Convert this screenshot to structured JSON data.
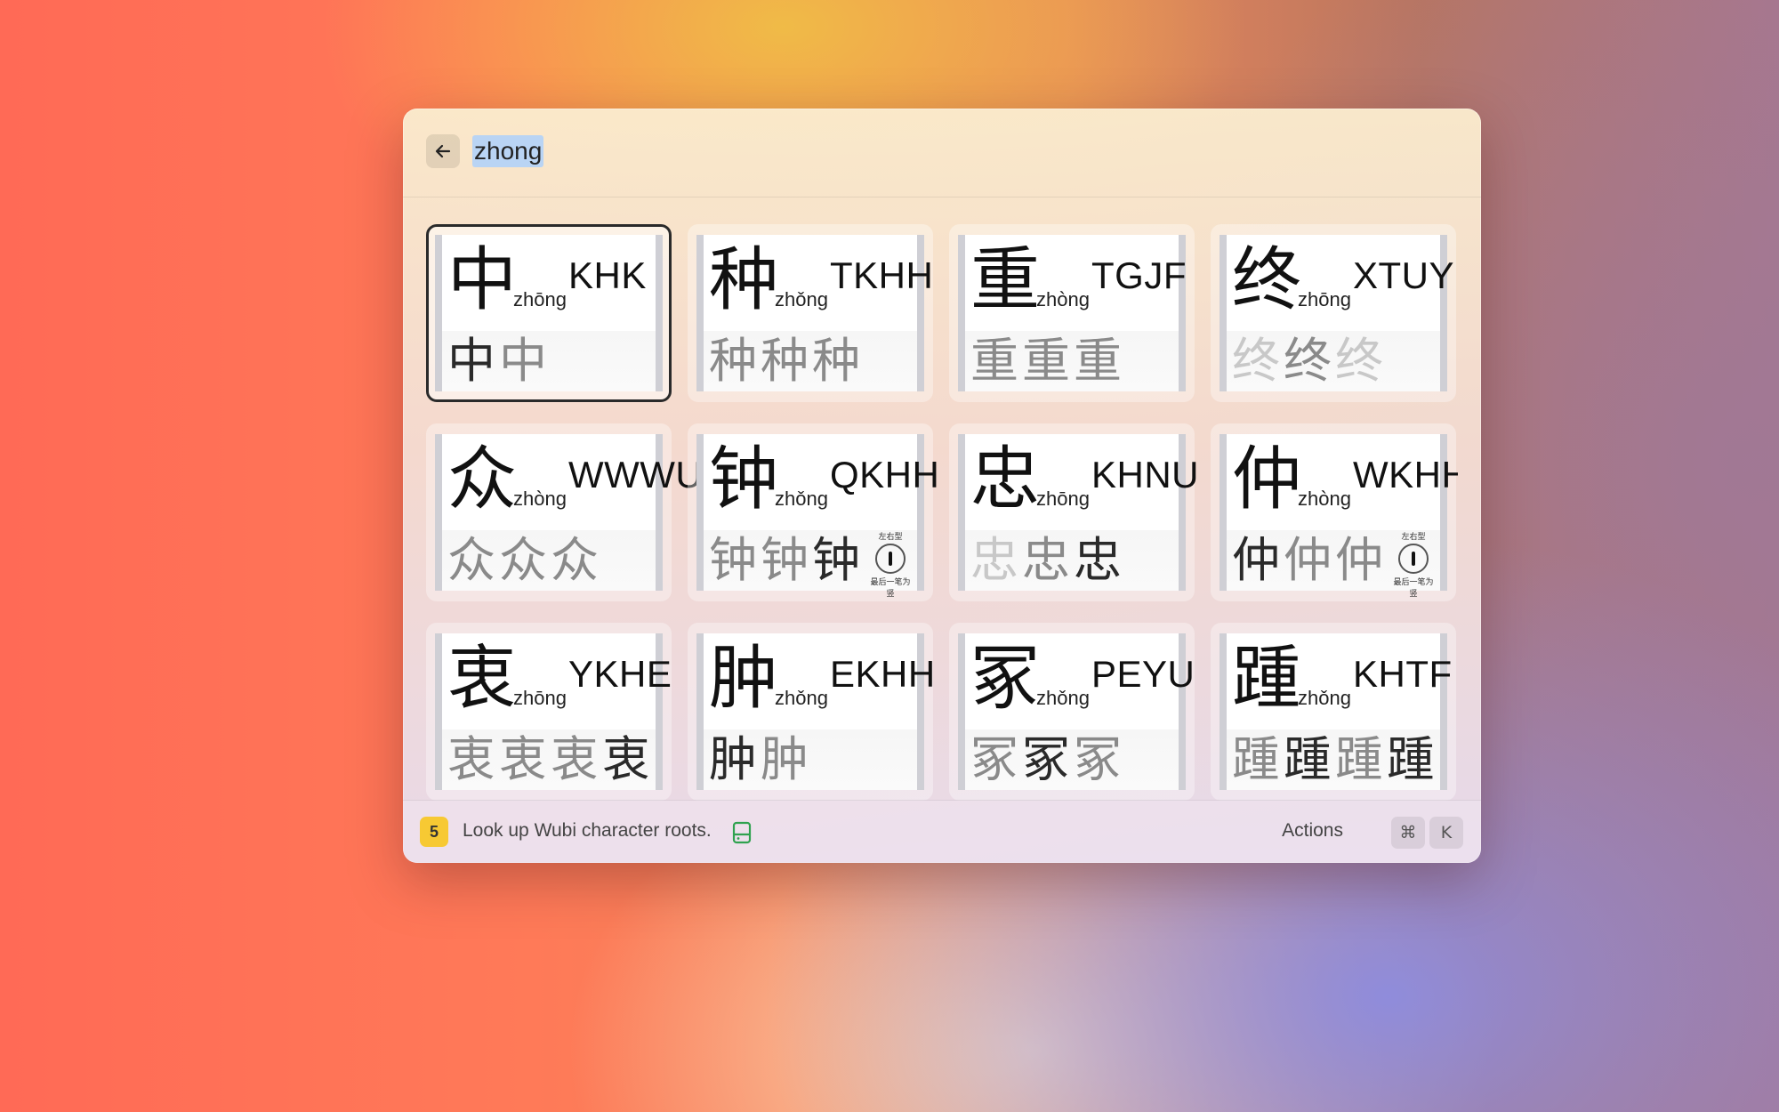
{
  "search": {
    "query": "zhong",
    "back_icon": "arrow-left-icon"
  },
  "results": [
    {
      "char": "中",
      "pinyin": "zhōng",
      "code": "KHK",
      "strokes": [
        "中",
        "中"
      ],
      "stroke_shades": [
        "s3",
        "s2"
      ],
      "selected": true,
      "rule_badge": false
    },
    {
      "char": "种",
      "pinyin": "zhǒng",
      "code": "TKHH",
      "strokes": [
        "种",
        "种",
        "种"
      ],
      "stroke_shades": [
        "s2",
        "s2",
        "s2"
      ],
      "selected": false,
      "rule_badge": false
    },
    {
      "char": "重",
      "pinyin": "zhòng",
      "code": "TGJF",
      "strokes": [
        "重",
        "重",
        "重"
      ],
      "stroke_shades": [
        "s2",
        "s2",
        "s2"
      ],
      "selected": false,
      "rule_badge": false
    },
    {
      "char": "终",
      "pinyin": "zhōng",
      "code": "XTUY",
      "strokes": [
        "终",
        "终",
        "终"
      ],
      "stroke_shades": [
        "s1",
        "s2",
        "s1"
      ],
      "selected": false,
      "rule_badge": false
    },
    {
      "char": "众",
      "pinyin": "zhòng",
      "code": "WWWU",
      "strokes": [
        "众",
        "众",
        "众"
      ],
      "stroke_shades": [
        "s2",
        "s2",
        "s2"
      ],
      "selected": false,
      "rule_badge": false
    },
    {
      "char": "钟",
      "pinyin": "zhǒng",
      "code": "QKHH",
      "strokes": [
        "钟",
        "钟",
        "钟"
      ],
      "stroke_shades": [
        "s2",
        "s2",
        "s3"
      ],
      "selected": false,
      "rule_badge": true
    },
    {
      "char": "忠",
      "pinyin": "zhōng",
      "code": "KHNU",
      "strokes": [
        "忠",
        "忠",
        "忠"
      ],
      "stroke_shades": [
        "s1",
        "s2",
        "s3"
      ],
      "selected": false,
      "rule_badge": false
    },
    {
      "char": "仲",
      "pinyin": "zhòng",
      "code": "WKHH",
      "strokes": [
        "仲",
        "仲",
        "仲"
      ],
      "stroke_shades": [
        "s3",
        "s2",
        "s2"
      ],
      "selected": false,
      "rule_badge": true
    },
    {
      "char": "衷",
      "pinyin": "zhōng",
      "code": "YKHE",
      "strokes": [
        "衷",
        "衷",
        "衷",
        "衷"
      ],
      "stroke_shades": [
        "s2",
        "s2",
        "s2",
        "s3"
      ],
      "selected": false,
      "rule_badge": false
    },
    {
      "char": "肿",
      "pinyin": "zhǒng",
      "code": "EKHH",
      "strokes": [
        "肿",
        "肿"
      ],
      "stroke_shades": [
        "s3",
        "s2"
      ],
      "selected": false,
      "rule_badge": false
    },
    {
      "char": "冢",
      "pinyin": "zhǒng",
      "code": "PEYU",
      "strokes": [
        "冢",
        "冢",
        "冢"
      ],
      "stroke_shades": [
        "s2",
        "s3",
        "s2"
      ],
      "selected": false,
      "rule_badge": false
    },
    {
      "char": "踵",
      "pinyin": "zhǒng",
      "code": "KHTF",
      "strokes": [
        "踵",
        "踵",
        "踵",
        "踵"
      ],
      "stroke_shades": [
        "s2",
        "s3",
        "s2",
        "s3"
      ],
      "selected": false,
      "rule_badge": false
    }
  ],
  "rule_badge": {
    "top": "左右型",
    "bottom": "最后一笔为竖"
  },
  "footer": {
    "badge": "5",
    "status": "Look up Wubi character roots.",
    "status_icon": "hard-drive-icon",
    "actions_label": "Actions",
    "key_cmd": "⌘",
    "key_k": "K"
  },
  "colors": {
    "badge_bg": "#f7c933",
    "drive_icon": "#2fa24f",
    "selection_bg": "#b9d4f4"
  }
}
